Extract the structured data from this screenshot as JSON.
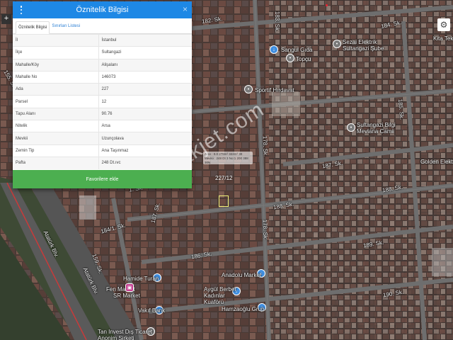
{
  "panel": {
    "title": "Öznitelik Bilgisi",
    "close": "×",
    "tabs": [
      "Öznitelik Bilgisi",
      "Sınırları Listesi"
    ],
    "rows": [
      {
        "key": "İl",
        "value": "İstanbul"
      },
      {
        "key": "İlçe",
        "value": "Sultangazi"
      },
      {
        "key": "Mahalle/Köy",
        "value": "Alişalanı"
      },
      {
        "key": "Mahalle No",
        "value": "146073"
      },
      {
        "key": "Ada",
        "value": "227"
      },
      {
        "key": "Parsel",
        "value": "12"
      },
      {
        "key": "Tapu Alanı",
        "value": "90.76"
      },
      {
        "key": "Nitelik",
        "value": "Arsa"
      },
      {
        "key": "Mevkii",
        "value": "Uzunçolava"
      },
      {
        "key": "Zemin Tip",
        "value": "Ana Taşınmaz"
      },
      {
        "key": "Pafta",
        "value": "248 Dt.ıvc"
      }
    ],
    "favorite_button": "Favorilere ekle"
  },
  "map": {
    "watermark": "emlakjet.com",
    "parcel_tooltip": [
      "Alan :  0.0 278m² 322m² 30",
      "Mevkii : 248 Dt 3 No:1 200 388 30N"
    ],
    "parcel_tag": "227/12",
    "streets": [
      "184. Sk.",
      "183. Sk.",
      "185. Sk.",
      "187. Sk.",
      "187. Sk.",
      "188. Sk.",
      "188. Sk.",
      "189. Sk.",
      "190. Sk.",
      "186. Sk.",
      "184/1. Sk.",
      "159. Sk.",
      "Atatürk Blv.",
      "Atatürk Blv.",
      "178. Sk.",
      "178. Sk.",
      "182. Sk.",
      "1. Sk.",
      "155. Sk."
    ],
    "pois": [
      "Sangul Gıda",
      "Sezai Elektrik Sultangazi Şube",
      "Topçu",
      "Sportif Hırdavat",
      "Sultangazi Bilgi Mevlana Camii",
      "Golden Elektrik",
      "Anadolu Market",
      "Aygül Berber Kadınlar Kuaförü",
      "Hamzaoğlu Grup",
      "Vakıf Bank",
      "Fen Market",
      "Tan Invest Dış Ticaret Anonim Şirketi",
      "Kita Tekstil",
      "Hamide Turan",
      "SR Market"
    ],
    "controls": {
      "plus": "+",
      "settings": "⚙"
    }
  }
}
